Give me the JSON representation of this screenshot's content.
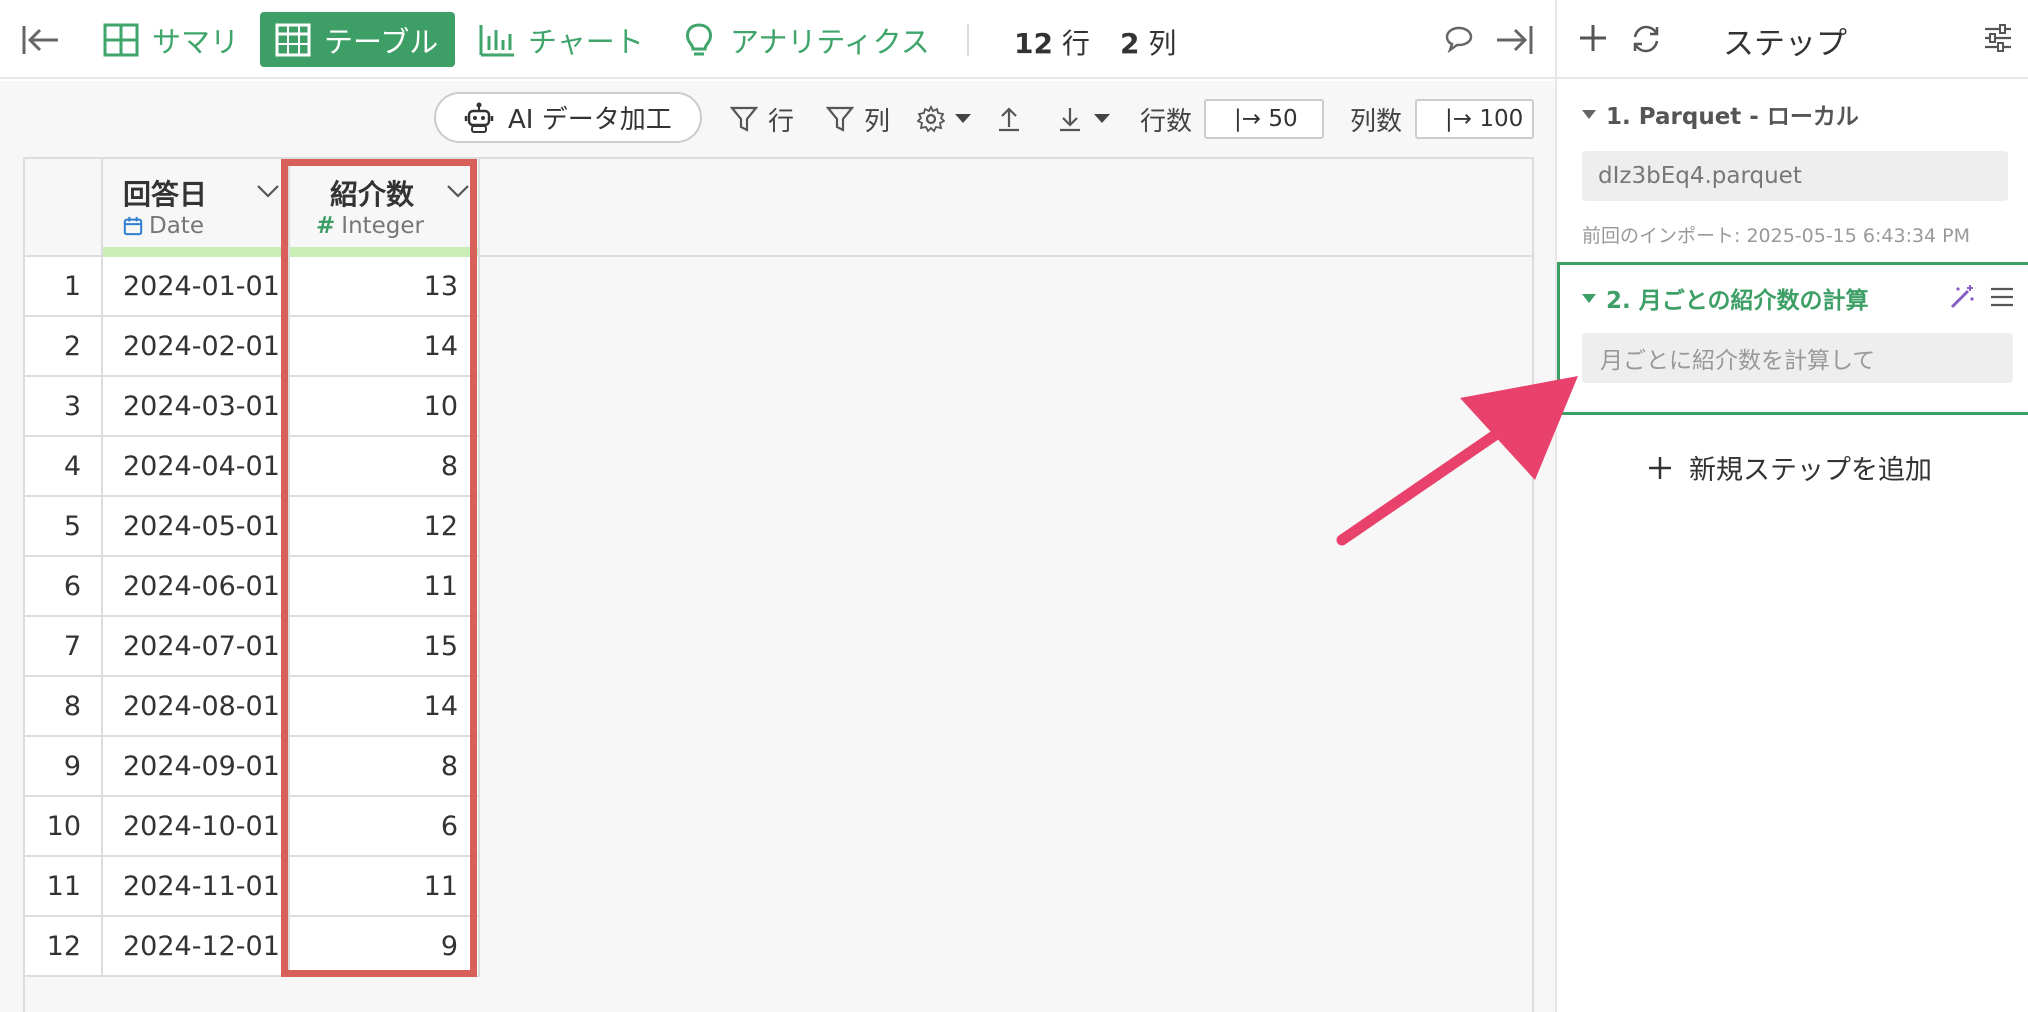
{
  "topbar": {
    "tabs": [
      {
        "label": "サマリ",
        "icon": "table-grid-icon"
      },
      {
        "label": "テーブル",
        "icon": "table-icon"
      },
      {
        "label": "チャート",
        "icon": "bar-chart-icon"
      },
      {
        "label": "アナリティクス",
        "icon": "lightbulb-icon"
      }
    ],
    "rows_count": "12",
    "rows_unit": "行",
    "cols_count": "2",
    "cols_unit": "列"
  },
  "toolbar": {
    "ai_label": "AI データ加工",
    "filter_rows": "行",
    "filter_cols": "列",
    "rows_label": "行数",
    "rows_value": "|→ 50",
    "cols_label": "列数",
    "cols_value": "|→ 100"
  },
  "columns": [
    {
      "name": "回答日",
      "type": "Date",
      "type_icon": "calendar-icon"
    },
    {
      "name": "紹介数",
      "type": "Integer",
      "type_icon": "hash-icon"
    }
  ],
  "rows": [
    {
      "idx": "1",
      "date": "2024-01-01",
      "value": "13"
    },
    {
      "idx": "2",
      "date": "2024-02-01",
      "value": "14"
    },
    {
      "idx": "3",
      "date": "2024-03-01",
      "value": "10"
    },
    {
      "idx": "4",
      "date": "2024-04-01",
      "value": "8"
    },
    {
      "idx": "5",
      "date": "2024-05-01",
      "value": "12"
    },
    {
      "idx": "6",
      "date": "2024-06-01",
      "value": "11"
    },
    {
      "idx": "7",
      "date": "2024-07-01",
      "value": "15"
    },
    {
      "idx": "8",
      "date": "2024-08-01",
      "value": "14"
    },
    {
      "idx": "9",
      "date": "2024-09-01",
      "value": "8"
    },
    {
      "idx": "10",
      "date": "2024-10-01",
      "value": "6"
    },
    {
      "idx": "11",
      "date": "2024-11-01",
      "value": "11"
    },
    {
      "idx": "12",
      "date": "2024-12-01",
      "value": "9"
    }
  ],
  "panel": {
    "title": "ステップ",
    "step1": {
      "title": "1. Parquet - ローカル",
      "file": "dIz3bEq4.parquet",
      "import": "前回のインポート: 2025-05-15 6:43:34 PM"
    },
    "step2": {
      "title": "2. 月ごとの紹介数の計算",
      "prompt": "月ごとに紹介数を計算して"
    },
    "add_step": "新規ステップを追加"
  },
  "colors": {
    "accent_green": "#3d9f66",
    "highlight_red": "#d9605a",
    "arrow_pink": "#e8416c"
  }
}
